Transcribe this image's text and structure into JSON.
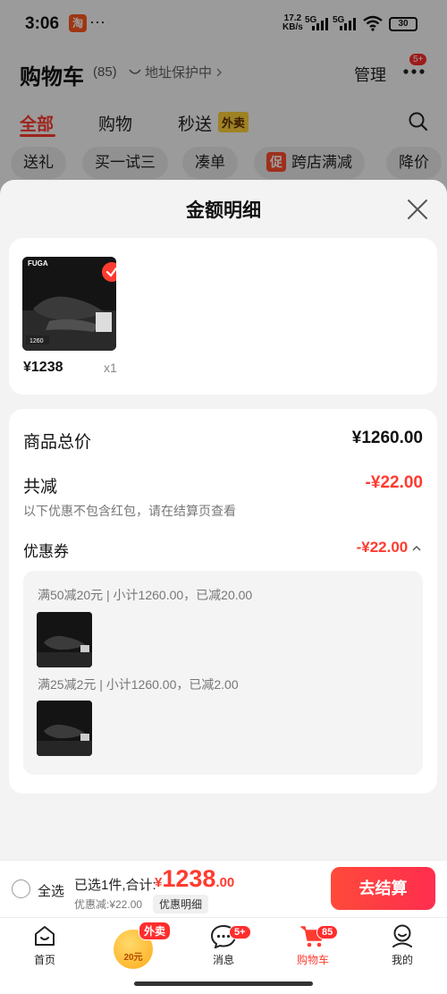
{
  "status": {
    "time": "3:06",
    "app_icon_char": "淘",
    "dots": "···",
    "speed_value": "17.2",
    "speed_unit": "KB/s",
    "signal1": "5G",
    "signal2": "5G",
    "battery": "30"
  },
  "header": {
    "title": "购物车",
    "count": "(85)",
    "address_protect": "地址保护中",
    "manage": "管理",
    "more_badge": "5+"
  },
  "tabs": [
    {
      "label": "全部"
    },
    {
      "label": "购物"
    },
    {
      "label": "秒送"
    }
  ],
  "waimai_tag": "外卖",
  "chips": [
    {
      "label": "送礼"
    },
    {
      "label": "买一试三"
    },
    {
      "label": "凑单"
    },
    {
      "label": "跨店满减",
      "promo_icon": "促"
    },
    {
      "label": "降价"
    }
  ],
  "sheet": {
    "title": "金额明细",
    "goods": {
      "brand": "FUGA",
      "thumb_price": "1260",
      "price": "¥1238",
      "qty": "x1"
    },
    "total_label": "商品总价",
    "total_value": "¥1260.00",
    "reduce_label": "共减",
    "reduce_value": "-¥22.00",
    "reduce_note": "以下优惠不包含红包，请在结算页查看",
    "coupon_label": "优惠券",
    "coupon_value": "-¥22.00",
    "coupon_lines": [
      {
        "text": "满50减20元 | 小计1260.00，已减20.00"
      },
      {
        "text": "满25减2元 | 小计1260.00，已减2.00"
      }
    ]
  },
  "checkout": {
    "select_all": "全选",
    "selected_text": "已选1件,合计:",
    "yen": "¥",
    "price_int": "1238",
    "price_dec": ".00",
    "discount_text": "优惠减:¥22.00",
    "detail_chip": "优惠明细",
    "button": "去结算"
  },
  "tabbar": {
    "home": "首页",
    "center_badge": "外卖",
    "center_amount": "20元",
    "messages": "消息",
    "messages_badge": "5+",
    "cart": "购物车",
    "cart_badge": "85",
    "mine": "我的"
  },
  "colors": {
    "accent": "#ff3b30",
    "checkout_button": "#ff3347",
    "promo": "#ff4d2e",
    "waimai": "#ffd23a"
  }
}
